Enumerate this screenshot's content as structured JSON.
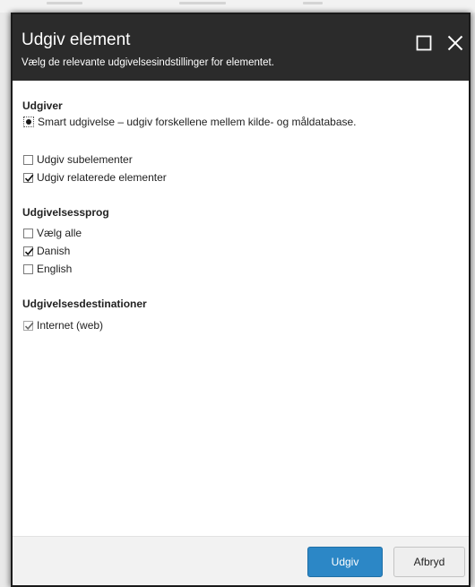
{
  "dialog": {
    "title": "Udgiv element",
    "subtitle": "Vælg de relevante udgivelsesindstillinger for elementet."
  },
  "publisher": {
    "heading": "Udgiver",
    "mode_label": "Smart udgivelse – udgiv forskellene mellem kilde- og måldatabase.",
    "mode_selected": true
  },
  "options": {
    "subitems_label": "Udgiv subelementer",
    "subitems_checked": false,
    "related_label": "Udgiv relaterede elementer",
    "related_checked": true
  },
  "languages": {
    "heading": "Udgivelsessprog",
    "items": [
      {
        "label": "Vælg alle",
        "checked": false
      },
      {
        "label": "Danish",
        "checked": true
      },
      {
        "label": "English",
        "checked": false
      }
    ]
  },
  "targets": {
    "heading": "Udgivelsesdestinationer",
    "items": [
      {
        "label": "Internet (web)",
        "checked": true,
        "disabled": true
      }
    ]
  },
  "footer": {
    "publish_label": "Udgiv",
    "cancel_label": "Afbryd"
  },
  "colors": {
    "header_bg": "#2b2b2b",
    "primary_button": "#2c87c6",
    "footer_bg": "#f2f2f2"
  }
}
